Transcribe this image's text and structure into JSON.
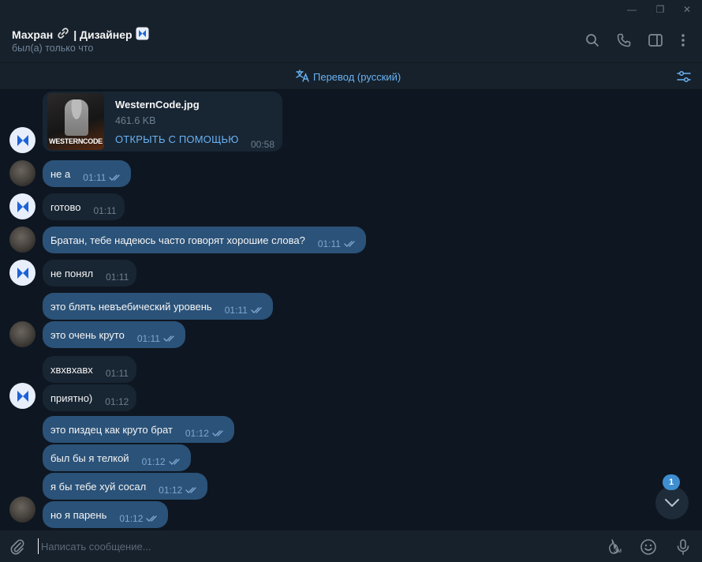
{
  "window": {
    "minimize": "—",
    "restore": "❐",
    "close": "✕"
  },
  "header": {
    "name": "Махран",
    "name_suffix": "| Дизайнер",
    "status": "был(а) только что"
  },
  "translate": {
    "label": "Перевод (русский)"
  },
  "file_message": {
    "file_name": "WesternCode.jpg",
    "file_size": "461.6 KB",
    "open_with": "ОТКРЫТЬ С ПОМОЩЬЮ",
    "time": "00:58",
    "thumb_text": "WESTERNCODE"
  },
  "messages": [
    {
      "text": "не а",
      "time": "01:11",
      "out": true
    },
    {
      "text": "готово",
      "time": "01:11",
      "out": false
    },
    {
      "text": "Братан, тебе надеюсь часто говорят хорошие слова?",
      "time": "01:11",
      "out": true
    },
    {
      "text": "не понял",
      "time": "01:11",
      "out": false
    },
    {
      "text": "это блять невъебический уровень",
      "time": "01:11",
      "out": true
    },
    {
      "text": "это очень круто",
      "time": "01:11",
      "out": true
    },
    {
      "text": "хвхвхавх",
      "time": "01:11",
      "out": false
    },
    {
      "text": "приятно)",
      "time": "01:12",
      "out": false
    },
    {
      "text": "это пиздец как круто брат",
      "time": "01:12",
      "out": true
    },
    {
      "text": "был бы я телкой",
      "time": "01:12",
      "out": true
    },
    {
      "text": "я бы тебе хуй сосал",
      "time": "01:12",
      "out": true
    },
    {
      "text": "но я парень",
      "time": "01:12",
      "out": true
    }
  ],
  "composer": {
    "placeholder": "Написать сообщение...",
    "sticker_badge": "3м"
  },
  "scroll": {
    "unread_count": "1"
  },
  "colors": {
    "background": "#0e1621",
    "panel": "#17212b",
    "incoming_bubble": "#182533",
    "outgoing_bubble": "#2b5278",
    "accent": "#6ab3f3",
    "badge": "#3e8ed0"
  }
}
